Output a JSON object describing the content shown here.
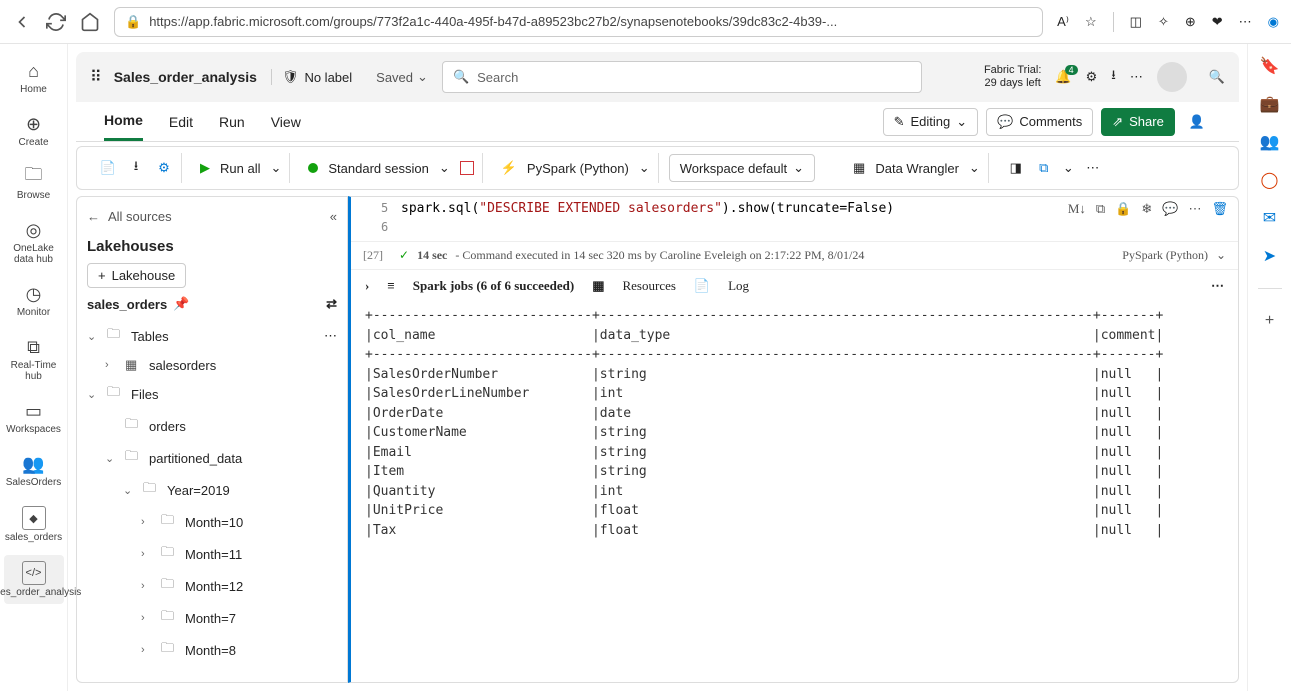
{
  "browser": {
    "url": "https://app.fabric.microsoft.com/groups/773f2a1c-440a-495f-b47d-a89523bc27b2/synapsenotebooks/39dc83c2-4b39-..."
  },
  "rail": {
    "items": [
      {
        "label": "Home"
      },
      {
        "label": "Create"
      },
      {
        "label": "Browse"
      },
      {
        "label": "OneLake data hub"
      },
      {
        "label": "Monitor"
      },
      {
        "label": "Real-Time hub"
      },
      {
        "label": "Workspaces"
      },
      {
        "label": "SalesOrders"
      },
      {
        "label": "sales_orders"
      },
      {
        "label": "Sales_order_analysis"
      }
    ]
  },
  "topbar": {
    "notebook_name": "Sales_order_analysis",
    "sensitivity": "No label",
    "saved": "Saved",
    "search_placeholder": "Search",
    "trial_line1": "Fabric Trial:",
    "trial_line2": "29 days left",
    "bell_badge": "4"
  },
  "ribbon": {
    "tabs": [
      "Home",
      "Edit",
      "Run",
      "View"
    ],
    "editing": "Editing",
    "comments": "Comments",
    "share": "Share"
  },
  "toolbar": {
    "run_all": "Run all",
    "session": "Standard session",
    "language": "PySpark (Python)",
    "environment": "Workspace default",
    "wrangler": "Data Wrangler"
  },
  "sidebar": {
    "all_sources": "All sources",
    "heading": "Lakehouses",
    "add_btn": "Lakehouse",
    "active": "sales_orders",
    "tables": "Tables",
    "salesorders": "salesorders",
    "files": "Files",
    "orders": "orders",
    "partitioned": "partitioned_data",
    "year": "Year=2019",
    "months": [
      "Month=10",
      "Month=11",
      "Month=12",
      "Month=7",
      "Month=8"
    ]
  },
  "cell": {
    "line5_num": "5",
    "line6_num": "6",
    "code_prefix": "spark.sql(",
    "code_str": "\"DESCRIBE EXTENDED salesorders\"",
    "code_suffix": ").show(truncate=False)",
    "prompt": "[27]",
    "exec_time": "14 sec",
    "exec_desc": " - Command executed in 14 sec 320 ms by Caroline Eveleigh on 2:17:22 PM, 8/01/24",
    "lang_tag": "PySpark (Python)",
    "jobs": "Spark jobs (6 of 6 succeeded)",
    "resources": "Resources",
    "log": "Log",
    "tools_md": "M↓"
  },
  "output_lines": [
    "+----------------------------+---------------------------------------------------------------+-------+",
    "|col_name                    |data_type                                                      |comment|",
    "+----------------------------+---------------------------------------------------------------+-------+",
    "|SalesOrderNumber            |string                                                         |null   |",
    "|SalesOrderLineNumber        |int                                                            |null   |",
    "|OrderDate                   |date                                                           |null   |",
    "|CustomerName                |string                                                         |null   |",
    "|Email                       |string                                                         |null   |",
    "|Item                        |string                                                         |null   |",
    "|Quantity                    |int                                                            |null   |",
    "|UnitPrice                   |float                                                          |null   |",
    "|Tax                         |float                                                          |null   |"
  ]
}
